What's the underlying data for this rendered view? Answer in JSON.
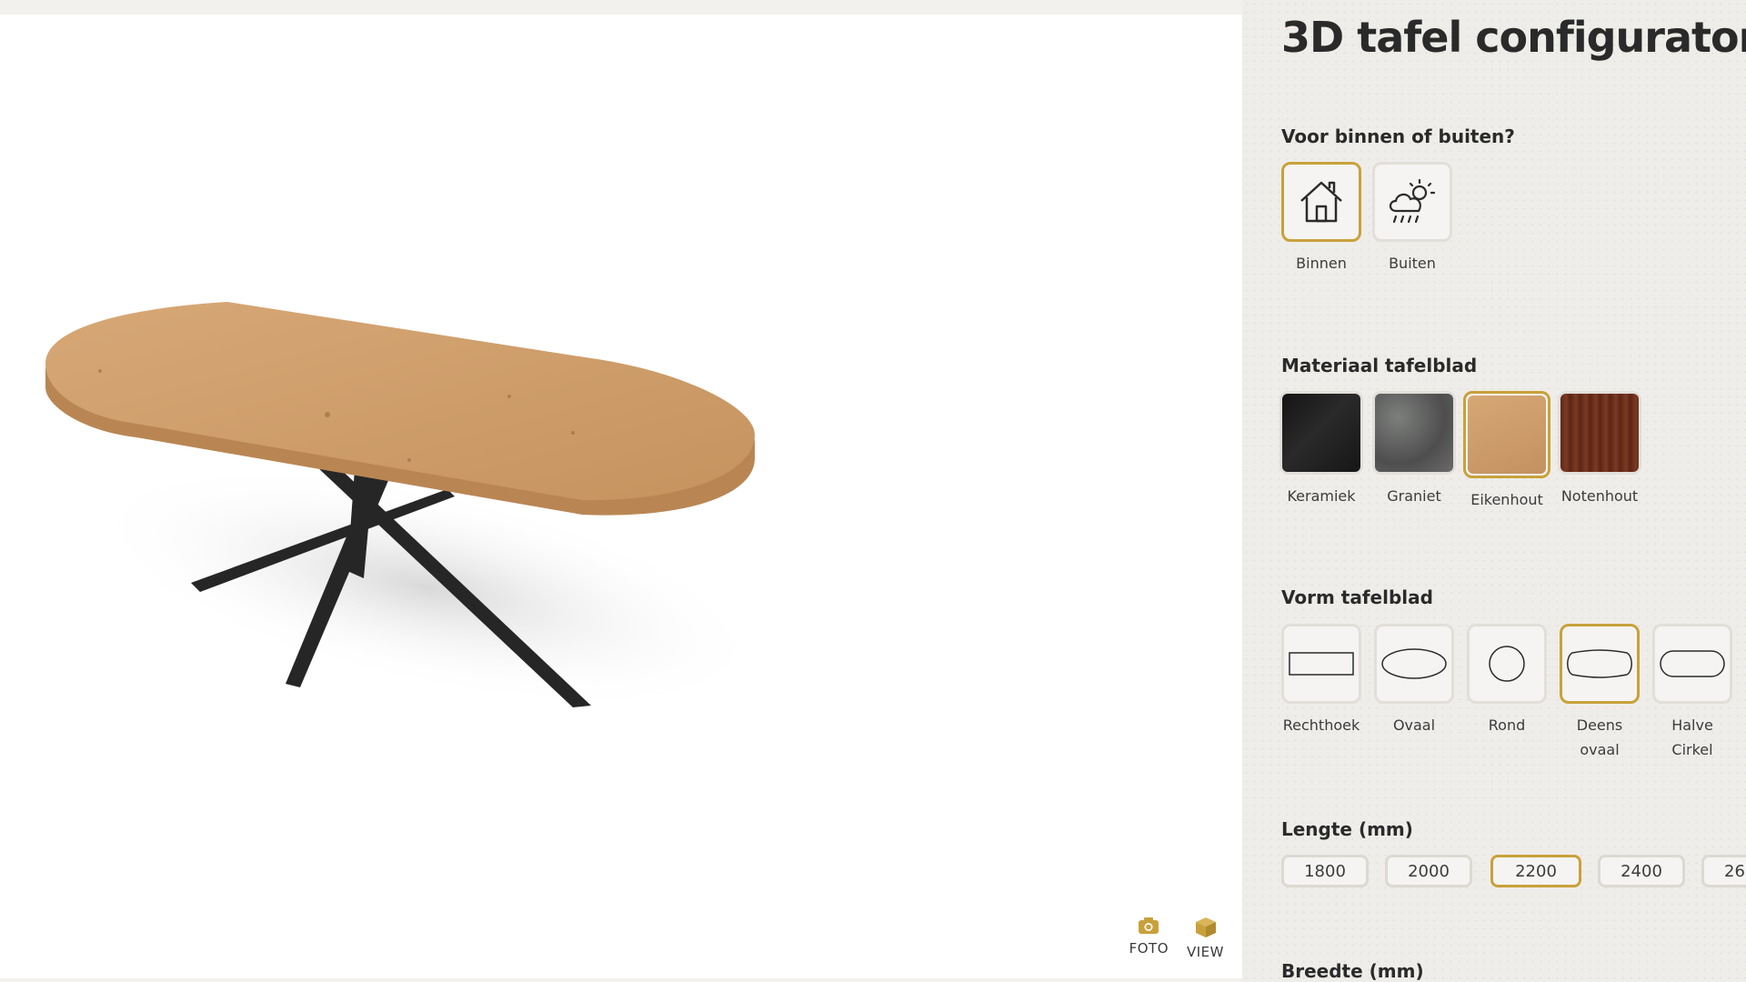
{
  "viewer": {
    "tools": [
      {
        "label": "FOTO",
        "icon": "camera-icon"
      },
      {
        "label": "VIEW",
        "icon": "cube-icon"
      }
    ],
    "accent": "#c9a13b"
  },
  "panel": {
    "title": "3D tafel configurator",
    "location": {
      "heading": "Voor binnen of buiten?",
      "options": [
        {
          "label": "Binnen",
          "icon": "house-icon",
          "selected": true
        },
        {
          "label": "Buiten",
          "icon": "weather-cloud-icon",
          "selected": false
        }
      ]
    },
    "material": {
      "heading": "Materiaal tafelblad",
      "options": [
        {
          "label": "Keramiek",
          "color": "#1c1c1c",
          "selected": false
        },
        {
          "label": "Graniet",
          "color": "#5e5f5e",
          "selected": false
        },
        {
          "label": "Eikenhout",
          "color": "#c99a64",
          "selected": true
        },
        {
          "label": "Notenhout",
          "color": "#6a2f1b",
          "selected": false
        }
      ]
    },
    "shape": {
      "heading": "Vorm tafelblad",
      "options": [
        {
          "label": "Rechthoek",
          "icon": "rectangle-shape-icon",
          "selected": false
        },
        {
          "label": "Ovaal",
          "icon": "oval-shape-icon",
          "selected": false
        },
        {
          "label": "Rond",
          "icon": "circle-shape-icon",
          "selected": false
        },
        {
          "label": "Deens ovaal",
          "line1": "Deens",
          "line2": "ovaal",
          "icon": "danish-oval-shape-icon",
          "selected": true
        },
        {
          "label": "Halve Cirkel",
          "line1": "Halve",
          "line2": "Cirkel",
          "icon": "half-circle-shape-icon",
          "selected": false
        }
      ]
    },
    "length": {
      "heading": "Lengte (mm)",
      "options": [
        "1800",
        "2000",
        "2200",
        "2400",
        "26"
      ],
      "selected": "2200"
    },
    "width": {
      "heading": "Breedte (mm)"
    }
  }
}
